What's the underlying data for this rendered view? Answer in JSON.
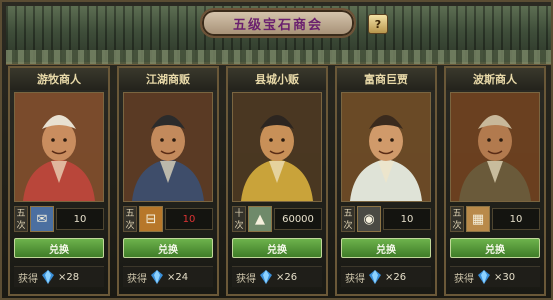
{
  "window": {
    "title": "五级宝石商会",
    "help_label": "?"
  },
  "merchants": [
    {
      "name": "游牧商人",
      "times": [
        "五",
        "次"
      ],
      "item_icon": "scroll-icon",
      "cost": "10",
      "cost_color": "normal",
      "button": "兑换",
      "gain_label": "获得",
      "gain": "×28",
      "robe": "#b9463a",
      "hat": "#e8e1d2",
      "skin": "#c98d5f",
      "bg": "#7a4b2c"
    },
    {
      "name": "江湖商贩",
      "times": [
        "五",
        "次"
      ],
      "item_icon": "token-icon",
      "cost": "10",
      "cost_color": "red",
      "button": "兑换",
      "gain_label": "获得",
      "gain": "×24",
      "robe": "#3e4d6a",
      "hat": "#2b2b2b",
      "skin": "#c38a5c",
      "bg": "#5a3a24"
    },
    {
      "name": "县城小贩",
      "times": [
        "十",
        "次"
      ],
      "item_icon": "silver-icon",
      "cost": "60000",
      "cost_color": "normal",
      "button": "兑换",
      "gain_label": "获得",
      "gain": "×26",
      "robe": "#c9a33a",
      "hat": "#2c2520",
      "skin": "#c89058",
      "bg": "#4a3722"
    },
    {
      "name": "富商巨贾",
      "times": [
        "五",
        "次"
      ],
      "item_icon": "coin-bag-icon",
      "cost": "10",
      "cost_color": "normal",
      "button": "兑换",
      "gain_label": "获得",
      "gain": "×26",
      "robe": "#dfe3d7",
      "hat": "#3a2a1d",
      "skin": "#d09a6a",
      "bg": "#6a4a26"
    },
    {
      "name": "波斯商人",
      "times": [
        "五",
        "次"
      ],
      "item_icon": "lantern-icon",
      "cost": "10",
      "cost_color": "normal",
      "button": "兑换",
      "gain_label": "获得",
      "gain": "×30",
      "robe": "#6a5a3a",
      "hat": "#c8b89a",
      "skin": "#b27a4e",
      "bg": "#6a4020"
    }
  ],
  "colors": {
    "accent_button": "#4f9a34",
    "gem": "#4aa8e8",
    "title_text": "#6a1f6e"
  }
}
